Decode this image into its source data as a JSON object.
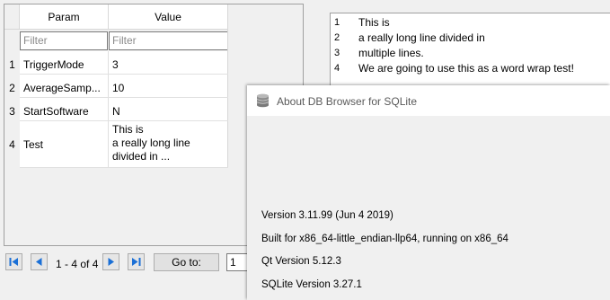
{
  "table": {
    "headers": {
      "param": "Param",
      "value": "Value"
    },
    "filter_placeholders": {
      "param": "Filter",
      "value": "Filter"
    },
    "rows": [
      {
        "num": "1",
        "param": "TriggerMode",
        "value": "3"
      },
      {
        "num": "2",
        "param": "AverageSamp...",
        "value": "10"
      },
      {
        "num": "3",
        "param": "StartSoftware",
        "value": "N"
      },
      {
        "num": "4",
        "param": "Test",
        "value_lines": [
          "This is",
          "a really long line",
          "divided in ..."
        ]
      }
    ]
  },
  "navigation": {
    "first_icon": "first-page-icon",
    "prev_icon": "previous-page-icon",
    "next_icon": "next-page-icon",
    "last_icon": "last-page-icon",
    "page_label": "1 - 4 of 4",
    "goto_label": "Go to:",
    "goto_value": "1"
  },
  "editor": {
    "lines": [
      {
        "num": "1",
        "text": "This is"
      },
      {
        "num": "2",
        "text": "a really long line divided in"
      },
      {
        "num": "3",
        "text": "multiple lines."
      },
      {
        "num": "4",
        "text": "We are going to use this as a word wrap test!"
      }
    ]
  },
  "about_dialog": {
    "icon": "database-icon",
    "title": "About DB Browser for SQLite",
    "version": "Version 3.11.99 (Jun  4 2019)",
    "built_for": "Built for x86_64-little_endian-llp64, running on x86_64",
    "qt_version": "Qt Version 5.12.3",
    "sqlite_version": "SQLite Version 3.27.1"
  },
  "colors": {
    "nav_icon": "#1a6fd6",
    "dialog_title_text": "#5a5a5a"
  }
}
